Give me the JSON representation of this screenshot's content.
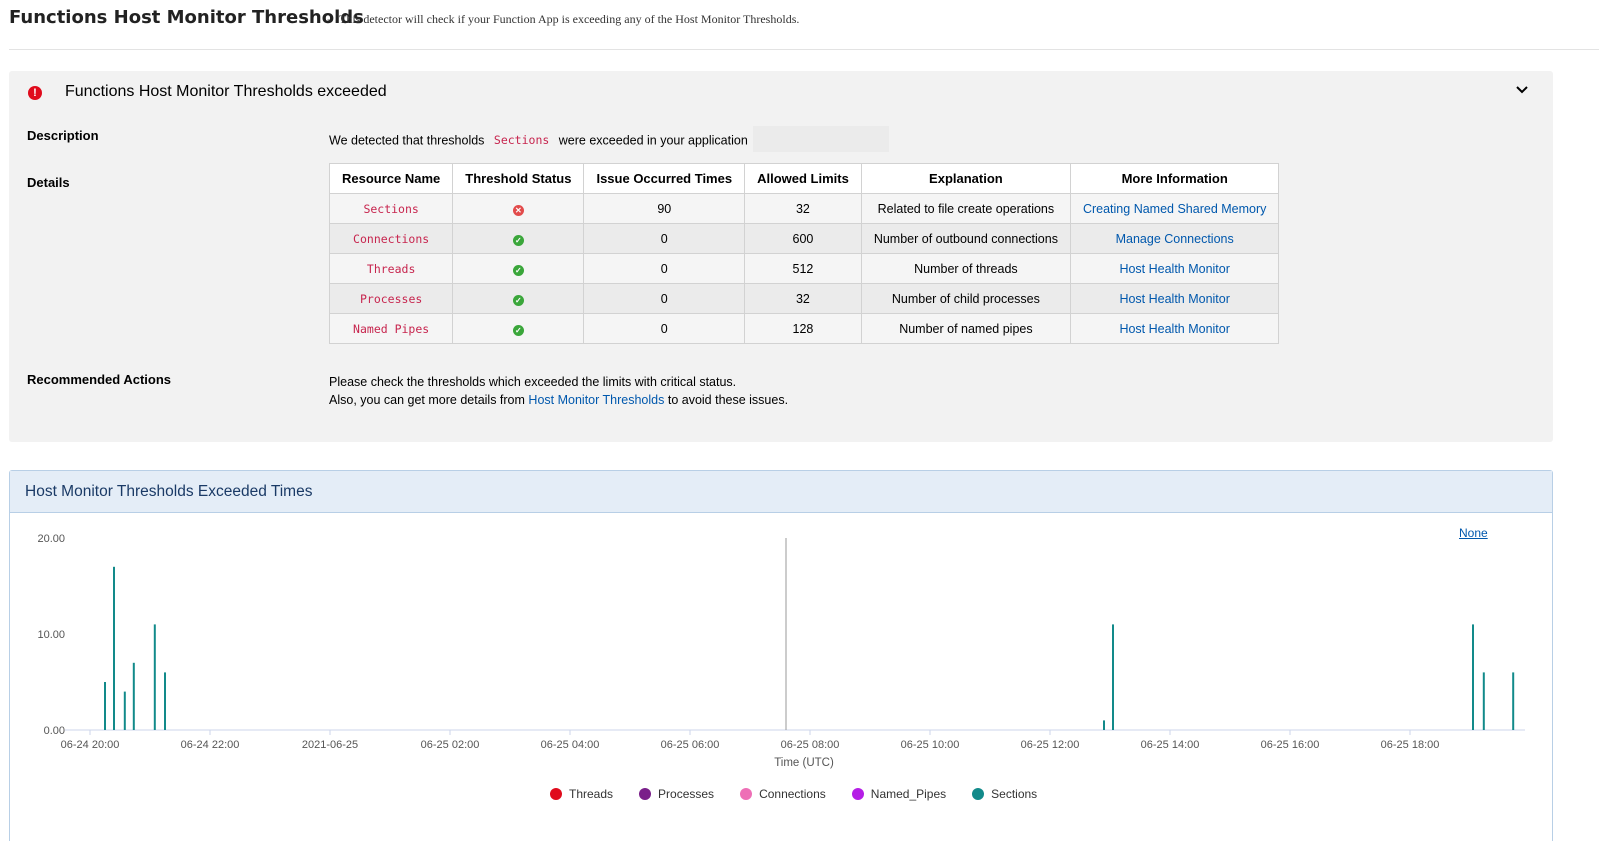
{
  "header": {
    "title": "Functions Host Monitor Thresholds",
    "separator": "-",
    "description": "This detector will check if your Function App is exceeding any of the Host Monitor Thresholds."
  },
  "alert": {
    "title": "Functions Host Monitor Thresholds exceeded",
    "status_color": "#e00b1c"
  },
  "description": {
    "label": "Description",
    "text_before": "We detected that thresholds",
    "resource": "Sections",
    "text_after": "were exceeded in your application"
  },
  "details": {
    "label": "Details",
    "columns": [
      "Resource Name",
      "Threshold Status",
      "Issue Occurred Times",
      "Allowed Limits",
      "Explanation",
      "More Information"
    ],
    "rows": [
      {
        "name": "Sections",
        "status": "critical",
        "times": "90",
        "limit": "32",
        "explanation": "Related to file create operations",
        "info": "Creating Named Shared Memory"
      },
      {
        "name": "Connections",
        "status": "ok",
        "times": "0",
        "limit": "600",
        "explanation": "Number of outbound connections",
        "info": "Manage Connections"
      },
      {
        "name": "Threads",
        "status": "ok",
        "times": "0",
        "limit": "512",
        "explanation": "Number of threads",
        "info": "Host Health Monitor"
      },
      {
        "name": "Processes",
        "status": "ok",
        "times": "0",
        "limit": "32",
        "explanation": "Number of child processes",
        "info": "Host Health Monitor"
      },
      {
        "name": "Named Pipes",
        "status": "ok",
        "times": "0",
        "limit": "128",
        "explanation": "Number of named pipes",
        "info": "Host Health Monitor"
      }
    ]
  },
  "recommended": {
    "label": "Recommended Actions",
    "line1": "Please check the thresholds which exceeded the limits with critical status.",
    "line2_before": "Also, you can get more details from",
    "line2_link": "Host Monitor Thresholds",
    "line2_after": "to avoid these issues."
  },
  "chart_panel": {
    "title": "Host Monitor Thresholds Exceeded Times",
    "none_label": "None"
  },
  "chart_data": {
    "type": "bar",
    "xlabel": "Time (UTC)",
    "ylabel": "",
    "ylim": [
      0,
      20
    ],
    "y_ticks": [
      "0.00",
      "10.00",
      "20.00"
    ],
    "x_tick_labels": [
      "06-24 20:00",
      "06-24 22:00",
      "2021-06-25",
      "06-25 02:00",
      "06-25 04:00",
      "06-25 06:00",
      "06-25 08:00",
      "06-25 10:00",
      "06-25 12:00",
      "06-25 14:00",
      "06-25 16:00",
      "06-25 18:00"
    ],
    "x_tick_hours": [
      0,
      2,
      4,
      6,
      8,
      10,
      12,
      14,
      16,
      18,
      20,
      22
    ],
    "cursor_hour": 11.6,
    "legend": [
      {
        "name": "Threads",
        "color": "#e00b1c"
      },
      {
        "name": "Processes",
        "color": "#7a1f8a"
      },
      {
        "name": "Connections",
        "color": "#ee6fb6"
      },
      {
        "name": "Named_Pipes",
        "color": "#b51ee6"
      },
      {
        "name": "Sections",
        "color": "#128a8a"
      }
    ],
    "series": [
      {
        "name": "Sections",
        "color": "#128a8a",
        "points": [
          {
            "hour": 0.25,
            "value": 5
          },
          {
            "hour": 0.4,
            "value": 17
          },
          {
            "hour": 0.58,
            "value": 4
          },
          {
            "hour": 0.73,
            "value": 7
          },
          {
            "hour": 1.08,
            "value": 11
          },
          {
            "hour": 1.25,
            "value": 6
          },
          {
            "hour": 16.9,
            "value": 1
          },
          {
            "hour": 17.05,
            "value": 11
          },
          {
            "hour": 23.05,
            "value": 11
          },
          {
            "hour": 23.23,
            "value": 6
          },
          {
            "hour": 23.72,
            "value": 6
          }
        ]
      }
    ]
  }
}
